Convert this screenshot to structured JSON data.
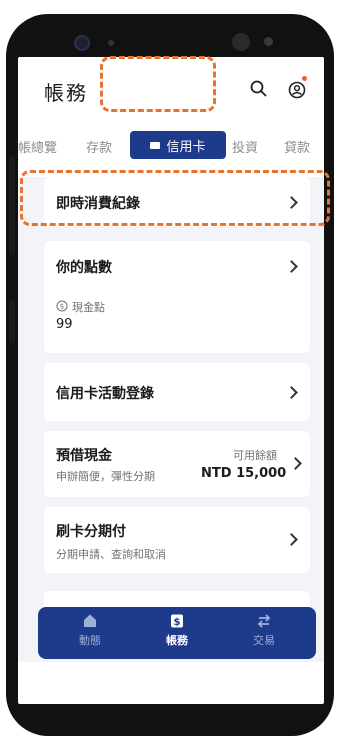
{
  "header": {
    "title": "帳務"
  },
  "tabs": [
    {
      "label": "帳總覽"
    },
    {
      "label": "存款"
    },
    {
      "label": "信用卡"
    },
    {
      "label": "投資"
    },
    {
      "label": "貸款"
    }
  ],
  "rows": {
    "instant": {
      "title": "即時消費紀錄"
    },
    "points": {
      "title": "你的點數",
      "sub_label": "現金點",
      "value": "99"
    },
    "events": {
      "title": "信用卡活動登錄"
    },
    "cash_advance": {
      "title": "預借現金",
      "subtitle": "申辦簡便，彈性分期",
      "avail_label": "可用餘額",
      "avail_value": "NTD 15,000"
    },
    "installment": {
      "title": "刷卡分期付",
      "subtitle": "分期申請、查詢和取消"
    }
  },
  "nav": [
    {
      "label": "動態",
      "icon": "home-icon"
    },
    {
      "label": "帳務",
      "icon": "dollar-icon"
    },
    {
      "label": "交易",
      "icon": "swap-icon"
    }
  ],
  "colors": {
    "brand": "#1e3a8a",
    "highlight": "#e8722f",
    "notification": "#e8632b"
  }
}
